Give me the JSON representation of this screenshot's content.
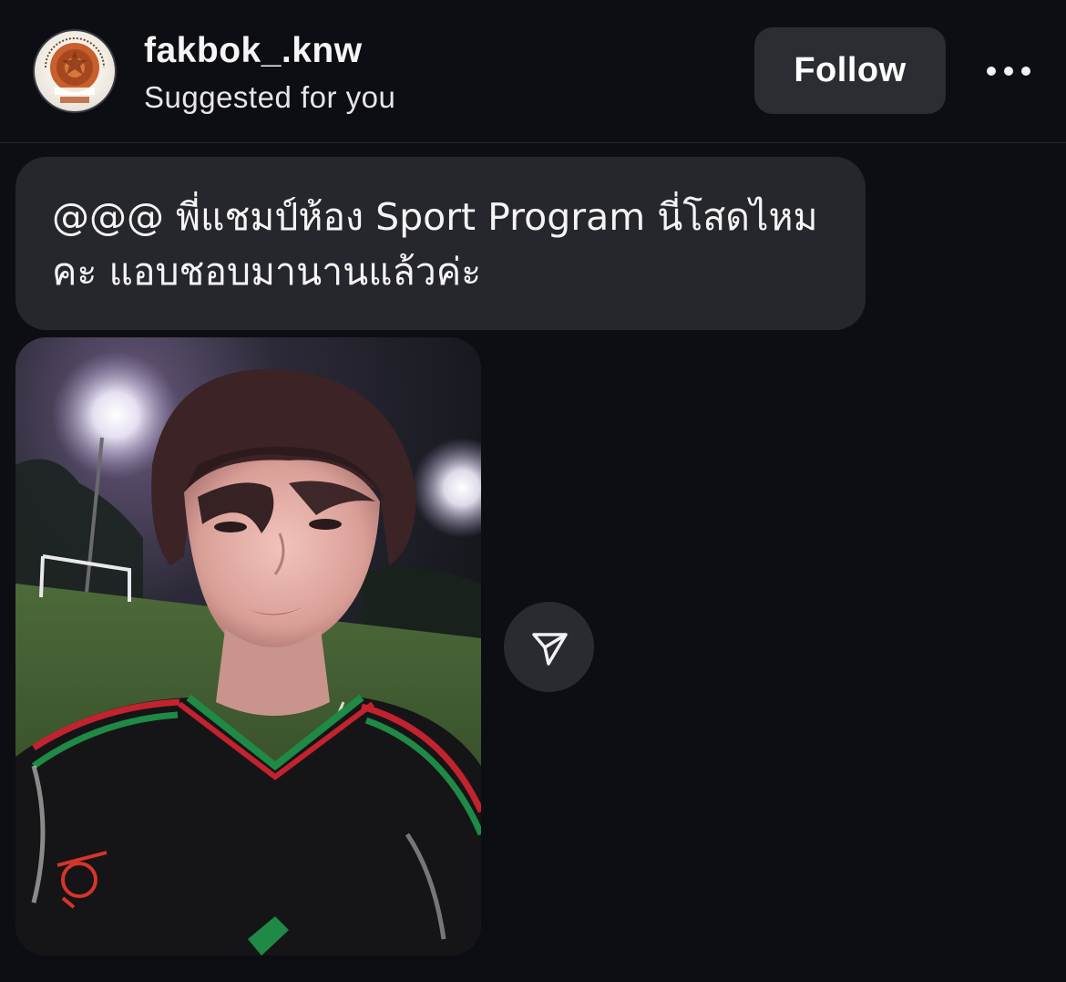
{
  "post_header": {
    "avatar_icon": "fakbok-logo-icon",
    "username": "fakbok_.knw",
    "subtitle": "Suggested for you",
    "follow_label": "Follow",
    "more_icon": "more-options-icon"
  },
  "message": {
    "text": "@@@ พี่แชมป์ห้อง Sport Program นี่โสดไหมคะ แอบชอบมานานแล้วค่ะ"
  },
  "attachment": {
    "image_icon": "selfie-photo",
    "share_icon": "send-share-icon"
  },
  "colors": {
    "background": "#0d0e13",
    "bubble": "#26272c",
    "button": "#2b2d33",
    "text": "#f2f2f2"
  }
}
